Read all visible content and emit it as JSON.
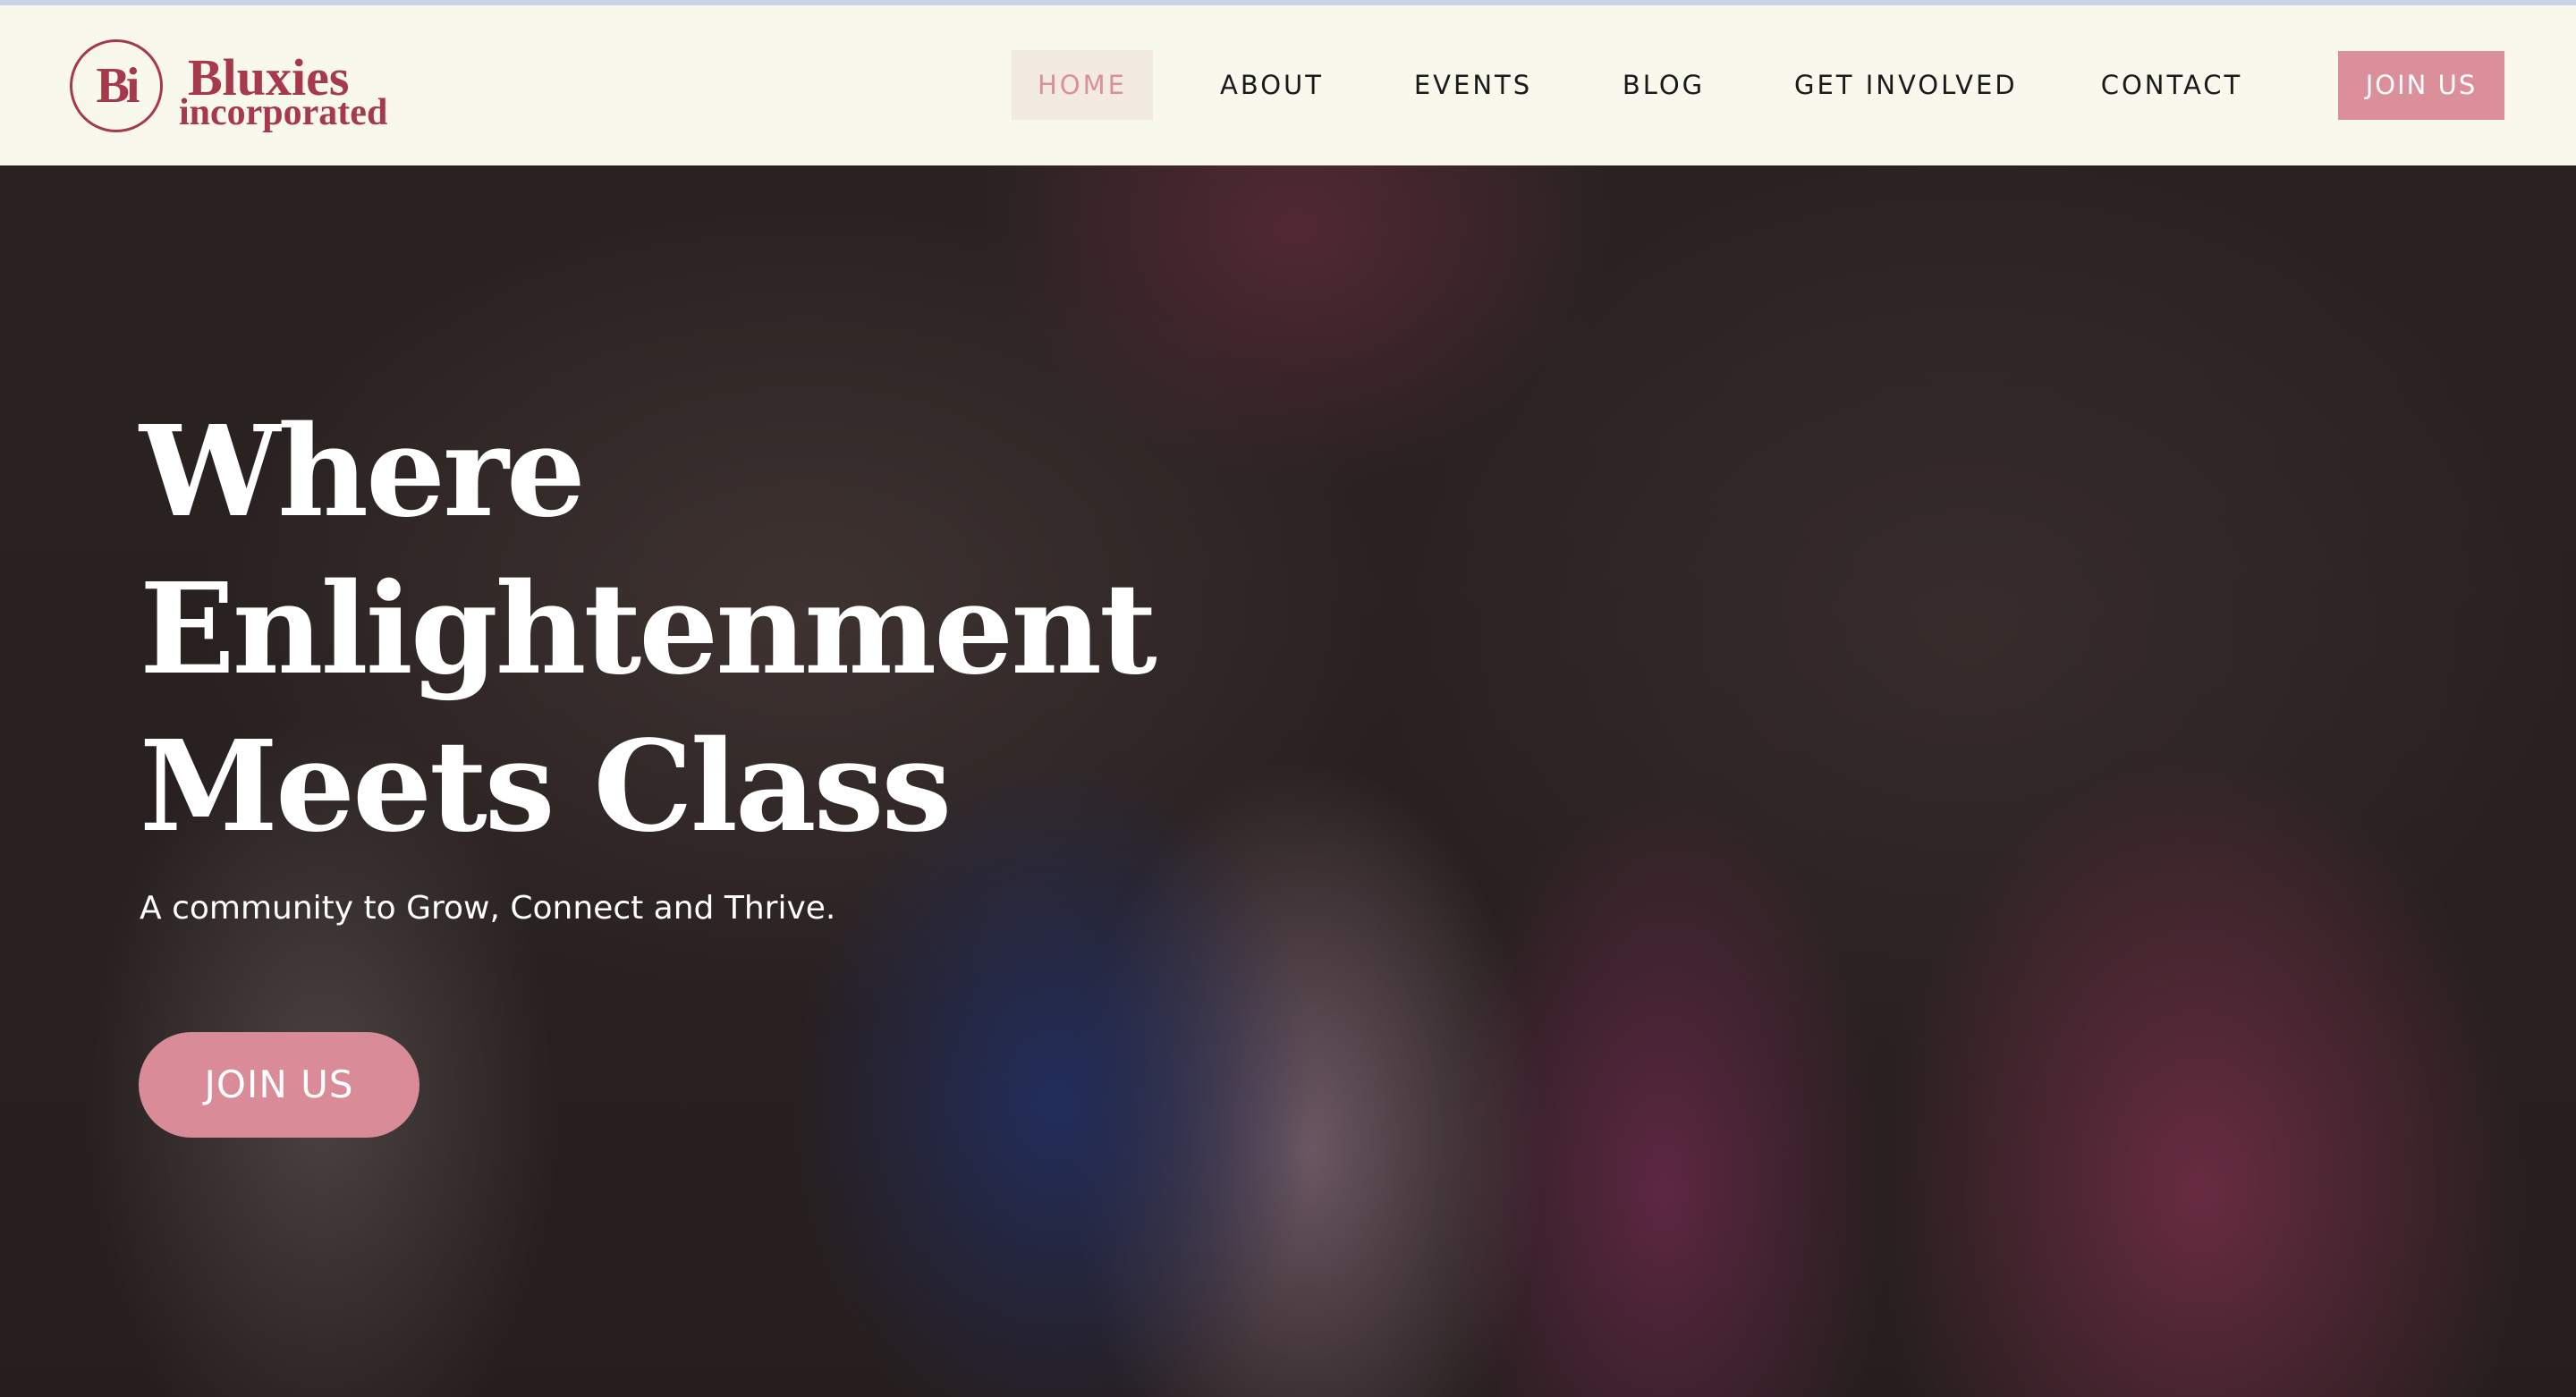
{
  "brand": {
    "mark": "Bi",
    "name_line1": "Bluxies",
    "name_line2": "incorporated",
    "accent": "#a63a4c"
  },
  "nav": {
    "items": [
      {
        "label": "HOME",
        "active": true
      },
      {
        "label": "ABOUT",
        "active": false
      },
      {
        "label": "EVENTS",
        "active": false
      },
      {
        "label": "BLOG",
        "active": false
      },
      {
        "label": "GET INVOLVED",
        "active": false
      },
      {
        "label": "CONTACT",
        "active": false
      }
    ],
    "cta_label": "JOIN US",
    "cta_color": "#db8f9b"
  },
  "hero": {
    "title_lines": [
      "Where",
      "Enlightenment",
      "Meets Class"
    ],
    "subtitle": "A community to Grow, Connect and Thrive.",
    "cta_label": "JOIN US",
    "cta_color": "#d98b98"
  }
}
